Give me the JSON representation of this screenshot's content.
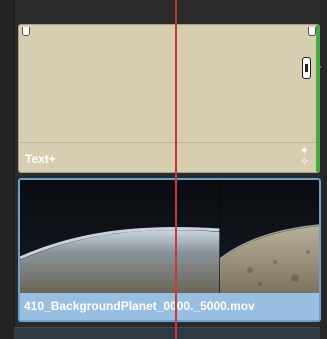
{
  "timeline": {
    "clips": [
      {
        "kind": "title",
        "label": "Text+",
        "color": "#d7cdb1",
        "edge_color": "#3fae3f",
        "icon": "sparkle-icon"
      },
      {
        "kind": "video",
        "label": "410_BackgroundPlanet_0000._5000.mov",
        "color": "#98bfe2"
      }
    ],
    "playhead_color": "#c23a3a"
  }
}
